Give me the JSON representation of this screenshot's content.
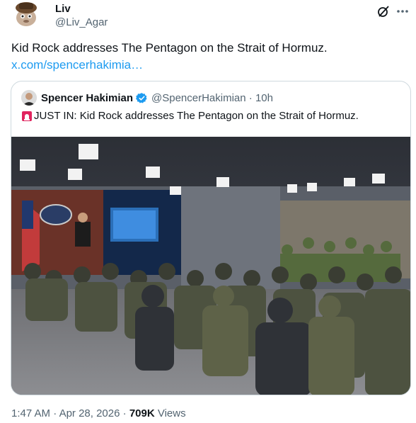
{
  "post": {
    "author_name": "Liv",
    "author_handle": "@Liv_Agar",
    "text": "Kid Rock addresses The Pentagon on the Strait of Hormuz.",
    "link_text": "x.com/spencerhakimia…",
    "more_icon": "more-icon",
    "grok_icon": "grok-icon"
  },
  "quote": {
    "author_name": "Spencer Hakimian",
    "verified_icon": "verified-badge-icon",
    "author_handle": "@SpencerHakimian",
    "separator": "·",
    "time": "10h",
    "text": "JUST IN: Kid Rock addresses The Pentagon on the Strait of Hormuz.",
    "text_icon": "siren-icon"
  },
  "meta": {
    "time": "1:47 AM",
    "separator": "·",
    "date": "Apr 28, 2026",
    "views_count": "709K",
    "views_label": "Views"
  },
  "colors": {
    "link": "#1d9bf0",
    "secondary": "#536471",
    "text": "#0f1419",
    "border": "#cfd9de"
  }
}
